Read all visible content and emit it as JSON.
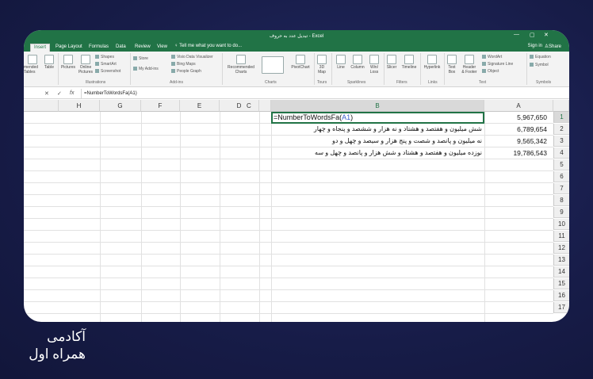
{
  "window": {
    "title": "تبدیل عدد به حروف - Excel"
  },
  "menu": {
    "tabs": [
      "Insert",
      "Page Layout",
      "Formulas",
      "Data",
      "Review",
      "View"
    ],
    "tell_me": "Tell me what you want to do...",
    "sign_in": "Sign in",
    "share": "Share"
  },
  "ribbon": {
    "items": {
      "recommended_tables": "mended\nTables",
      "table": "Table",
      "pictures": "Pictures",
      "online_pictures": "Online\nPictures",
      "shapes": "Shapes",
      "smartart": "SmartArt",
      "screenshot": "Screenshot",
      "store": "Store",
      "my_addins": "My Add-ins",
      "visio": "Visio Data Visualizer",
      "bing_maps": "Bing Maps",
      "people_graph": "People Graph",
      "recommended_charts": "Recommended\nCharts",
      "pivotchart": "PivotChart",
      "map_3d": "3D\nMap",
      "line": "Line",
      "column": "Column",
      "winloss": "Win/\nLoss",
      "slicer": "Slicer",
      "timeline": "Timeline",
      "hyperlink": "Hyperlink",
      "text_box": "Text\nBox",
      "header_footer": "Header\n& Footer",
      "wordart": "WordArt",
      "signature_line": "Signature Line",
      "object": "Object",
      "equation": "Equation",
      "symbol": "Symbol"
    },
    "groups": {
      "illustrations": "Illustrations",
      "addins": "Add-ins",
      "charts": "Charts",
      "tours": "Tours",
      "sparklines": "Sparklines",
      "filters": "Filters",
      "links": "Links",
      "text": "Text",
      "symbols": "Symbols"
    }
  },
  "formula_bar": {
    "cancel": "✕",
    "enter": "✓",
    "fx": "fx",
    "formula": "=NumberToWordsFa(A1)"
  },
  "sheet": {
    "columns": [
      "H",
      "G",
      "F",
      "E",
      "D",
      "C",
      "B",
      "A"
    ],
    "selected_column": "B",
    "rows": [
      "1",
      "2",
      "3",
      "4",
      "5",
      "6",
      "7",
      "8",
      "9",
      "10",
      "11",
      "12",
      "13",
      "14",
      "15",
      "16",
      "17"
    ],
    "selected_row": "1",
    "editing": {
      "prefix": "=NumberToWordsFa(",
      "ref": "A1",
      "suffix": ")"
    },
    "colA": [
      "5,967,650",
      "6,789,654",
      "9,565,342",
      "19,786,543"
    ],
    "colB": [
      "",
      "شش میلیون و هفتصد و هشتاد و نه هزار و ششصد و پنجاه و چهار",
      "نه میلیون و پانصد و شصت و پنج هزار و سیصد و چهل و دو",
      "نوزده میلیون و هفتصد و هشتاد و شش هزار و پانصد و چهل و سه"
    ]
  },
  "branding": {
    "line1": "آکادمی",
    "line2": "همراه اول"
  },
  "colors": {
    "excel_green": "#217346",
    "background": "#1a1f4e"
  }
}
